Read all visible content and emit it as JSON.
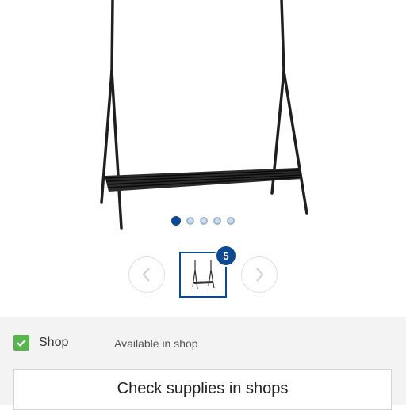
{
  "product": {
    "image_name": "clothes-rack-with-shoe-shelf",
    "gallery": {
      "dot_count": 5,
      "active_dot": 1,
      "thumbnail_badge": "5"
    }
  },
  "availability": {
    "channel_label": "Shop",
    "checked": true,
    "status_text": "Available in shop",
    "check_button_label": "Check supplies in shops"
  },
  "colors": {
    "accent": "#0d4a91",
    "check_green": "#58b44d",
    "panel_bg": "#f3f3f3"
  },
  "icons": {
    "prev": "chevron-left-icon",
    "next": "chevron-right-icon",
    "check": "checkmark-icon"
  }
}
